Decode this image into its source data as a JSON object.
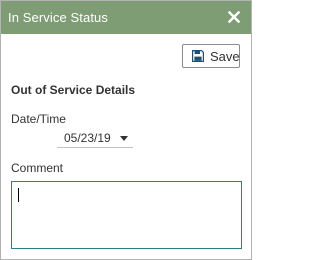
{
  "dialog": {
    "title": "In Service Status",
    "close_icon": "close-icon",
    "header_color": "#7e9d74"
  },
  "toolbar": {
    "save_label": "Save",
    "save_icon": "save-icon"
  },
  "details": {
    "heading": "Out of Service Details",
    "datetime_label": "Date/Time",
    "datetime_value": "05/23/19",
    "datetime_icon": "chevron-down-icon",
    "comment_label": "Comment",
    "comment_value": "",
    "comment_border_color": "#2f7d8a"
  }
}
